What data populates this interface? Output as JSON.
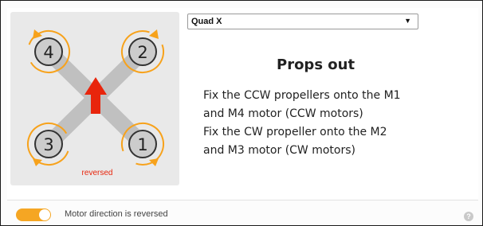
{
  "frame_select": {
    "value": "Quad X"
  },
  "diagram": {
    "motor_labels": [
      "4",
      "2",
      "3",
      "1"
    ],
    "reversed_label": "reversed",
    "colors": {
      "arm": "#c0c0c0",
      "motor": "#cccccc",
      "outline": "#333333",
      "direction": "#f7a21b",
      "forward_arrow": "#e8250c",
      "reversed_text": "#e8250c"
    },
    "icons": [
      "forward-arrow-icon",
      "rotation-arrow-icon"
    ]
  },
  "instructions": {
    "title": "Props out",
    "lines": [
      "Fix the CCW propellers onto the M1",
      "and M4 motor (CCW motors)",
      "Fix the CW propeller onto the M2",
      "and M3 motor (CW motors)"
    ]
  },
  "footer": {
    "toggle_on": true,
    "toggle_color": "#f5a623",
    "toggle_label": "Motor direction is reversed",
    "help_icon": "?"
  }
}
